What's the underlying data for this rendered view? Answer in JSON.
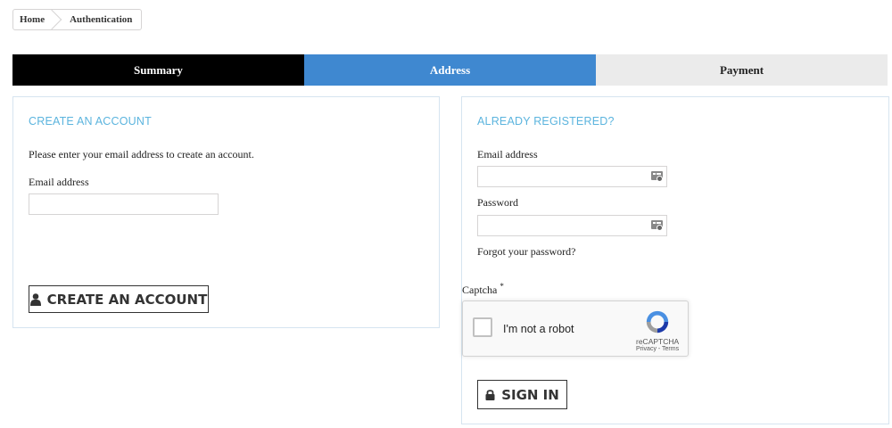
{
  "breadcrumb": {
    "home": "Home",
    "current": "Authentication"
  },
  "steps": {
    "summary": "Summary",
    "address": "Address",
    "payment": "Payment"
  },
  "create_account": {
    "title": "CREATE AN ACCOUNT",
    "instructions": "Please enter your email address to create an account.",
    "email_label": "Email address",
    "email_value": "",
    "button_label": "CREATE AN ACCOUNT",
    "button_icon": "user-icon"
  },
  "login": {
    "title": "ALREADY REGISTERED?",
    "email_label": "Email address",
    "email_value": "",
    "password_label": "Password",
    "password_value": "",
    "field_icon": "password-manager-icon",
    "forgot_link": "Forgot your password?",
    "captcha_label": "Captcha",
    "captcha_required_mark": "*",
    "recaptcha": {
      "checkbox_text": "I'm not a robot",
      "brand": "reCAPTCHA",
      "links": "Privacy - Terms",
      "checked": false
    },
    "button_label": "SIGN IN",
    "button_icon": "lock-icon"
  },
  "colors": {
    "step_active_bg": "#000000",
    "step_current_bg": "#3f88d0",
    "step_next_bg": "#ebebeb",
    "panel_title": "#5bb4de",
    "panel_border": "#d6e4f0"
  }
}
